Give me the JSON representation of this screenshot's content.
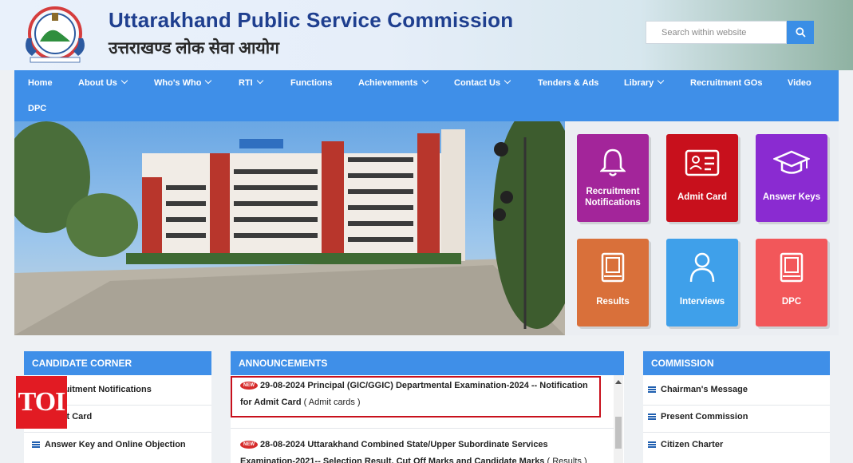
{
  "header": {
    "title_en": "Uttarakhand Public Service Commission",
    "title_hi": "उत्तराखण्ड लोक सेवा आयोग",
    "search_placeholder": "Search within website"
  },
  "nav": {
    "items": [
      {
        "label": "Home",
        "dropdown": false
      },
      {
        "label": "About Us",
        "dropdown": true
      },
      {
        "label": "Who's Who",
        "dropdown": true
      },
      {
        "label": "RTI",
        "dropdown": true
      },
      {
        "label": "Functions",
        "dropdown": false
      },
      {
        "label": "Achievements",
        "dropdown": true
      },
      {
        "label": "Contact Us",
        "dropdown": true
      },
      {
        "label": "Tenders & Ads",
        "dropdown": false
      },
      {
        "label": "Library",
        "dropdown": true
      },
      {
        "label": "Recruitment GOs",
        "dropdown": false
      },
      {
        "label": "Video",
        "dropdown": false
      },
      {
        "label": "DPC",
        "dropdown": false
      }
    ]
  },
  "tiles": [
    {
      "label": "Recruitment Notifications",
      "icon": "bell-icon",
      "color": "#a3259a"
    },
    {
      "label": "Admit Card",
      "icon": "id-card-icon",
      "color": "#c8101c"
    },
    {
      "label": "Answer Keys",
      "icon": "graduation-cap-icon",
      "color": "#8a2bd1"
    },
    {
      "label": "Results",
      "icon": "book-icon",
      "color": "#d9703a"
    },
    {
      "label": "Interviews",
      "icon": "user-icon",
      "color": "#3fa0ea"
    },
    {
      "label": "DPC",
      "icon": "book-icon",
      "color": "#f2575a"
    }
  ],
  "candidate_corner": {
    "title": "CANDIDATE CORNER",
    "items": [
      "Recruitment Notifications",
      "Admit Card",
      "Answer Key and Online Objection"
    ]
  },
  "announcements": {
    "title": "ANNOUNCEMENTS",
    "badge": "NEW",
    "items": [
      {
        "text": "29-08-2024 Principal (GIC/GGIC) Departmental Examination-2024 -- Notification for Admit Card",
        "link": "( Admit cards )"
      },
      {
        "text": "28-08-2024 Uttarakhand Combined State/Upper Subordinate Services Examination-2021-- Selection Result, Cut Off Marks and Candidate Marks",
        "link": "( Results )"
      }
    ]
  },
  "commission": {
    "title": "COMMISSION",
    "items": [
      "Chairman's Message",
      "Present Commission",
      "Citizen Charter"
    ]
  },
  "watermark": "TOI"
}
